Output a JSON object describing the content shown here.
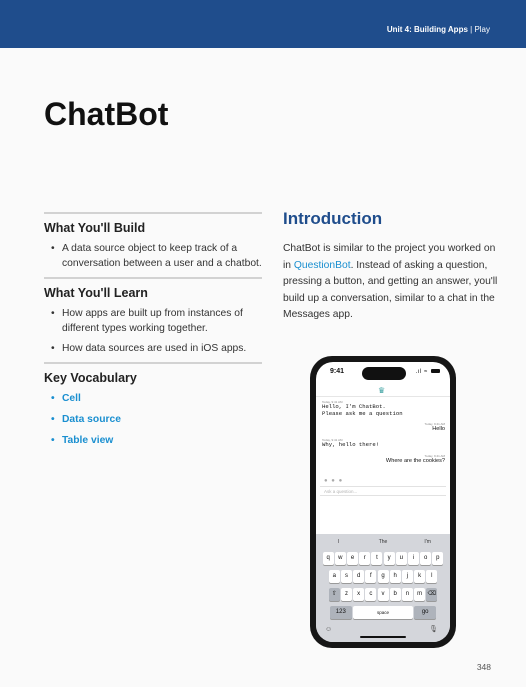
{
  "header": {
    "unit_bold": "Unit 4: Building Apps",
    "separator": " | ",
    "section": "Play",
    "bar_color": "#1f4d8c"
  },
  "title": "ChatBot",
  "build": {
    "heading": "What You'll Build",
    "items": [
      "A data source object to keep track of a conversation between a user and a chatbot."
    ]
  },
  "learn": {
    "heading": "What You'll Learn",
    "items": [
      "How apps are built up from instances of different types working together.",
      "How data sources are used in iOS apps."
    ]
  },
  "vocab": {
    "heading": "Key Vocabulary",
    "items": [
      "Cell",
      "Data source",
      "Table view"
    ],
    "color": "#1a8fd0"
  },
  "intro": {
    "heading": "Introduction",
    "text_before": "ChatBot is similar to the project you worked on in ",
    "link": "QuestionBot",
    "text_after": ". Instead of asking a question, pressing a button, and getting an answer, you'll build up a conversation, similar to a chat in the Messages app."
  },
  "phone": {
    "time": "9:41",
    "messages": [
      {
        "side": "left",
        "timestamp": "Today, 9:41 AM",
        "lines": [
          "Hello, I'm ChatBot.",
          "Please ask me a question"
        ]
      },
      {
        "side": "right",
        "timestamp": "Today, 9:41 AM",
        "lines": [
          "Hello"
        ]
      },
      {
        "side": "left",
        "timestamp": "Today, 9:41 AM",
        "lines": [
          "Why, hello there!"
        ]
      },
      {
        "side": "right",
        "timestamp": "Today, 9:41 AM",
        "lines": [
          "Where are the cookies?"
        ]
      }
    ],
    "typing": "● ● ●",
    "input_placeholder": "Ask a question...",
    "suggestions": [
      "I",
      "The",
      "I'm"
    ],
    "keys_row1": [
      "q",
      "w",
      "e",
      "r",
      "t",
      "y",
      "u",
      "i",
      "o",
      "p"
    ],
    "keys_row2": [
      "a",
      "s",
      "d",
      "f",
      "g",
      "h",
      "j",
      "k",
      "l"
    ],
    "keys_row3": [
      "z",
      "x",
      "c",
      "v",
      "b",
      "n",
      "m"
    ],
    "key_shift": "⇧",
    "key_delete": "⌫",
    "key_123": "123",
    "key_space": "space",
    "key_go": "go",
    "emoji_icon": "☺",
    "mic_icon": "🎙"
  },
  "page_number": "348"
}
